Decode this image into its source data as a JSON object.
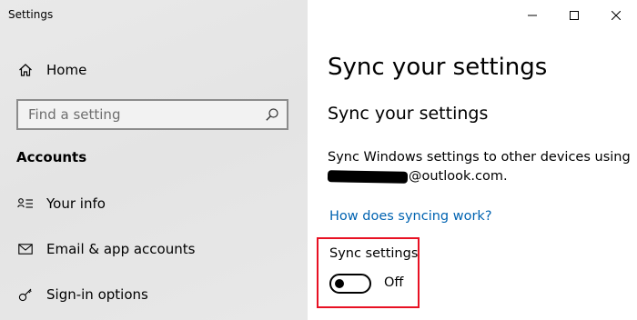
{
  "window": {
    "title": "Settings"
  },
  "sidebar": {
    "home": {
      "label": "Home",
      "icon": "home-icon"
    },
    "search": {
      "placeholder": "Find a setting",
      "icon": "search-icon"
    },
    "section_heading": "Accounts",
    "items": [
      {
        "label": "Your info",
        "icon": "person-lines-icon"
      },
      {
        "label": "Email & app accounts",
        "icon": "mail-icon"
      },
      {
        "label": "Sign-in options",
        "icon": "key-icon"
      }
    ]
  },
  "content": {
    "page_title": "Sync your settings",
    "sub_title": "Sync your settings",
    "description_line1": "Sync Windows settings to other devices using",
    "email_domain": "@outlook.com.",
    "help_link": "How does syncing work?",
    "sync_settings": {
      "label": "Sync settings",
      "state": "Off",
      "on": false
    }
  },
  "colors": {
    "link": "#0063b1",
    "highlight_border": "#e81123",
    "sidebar_bg": "#e6e6e6"
  }
}
